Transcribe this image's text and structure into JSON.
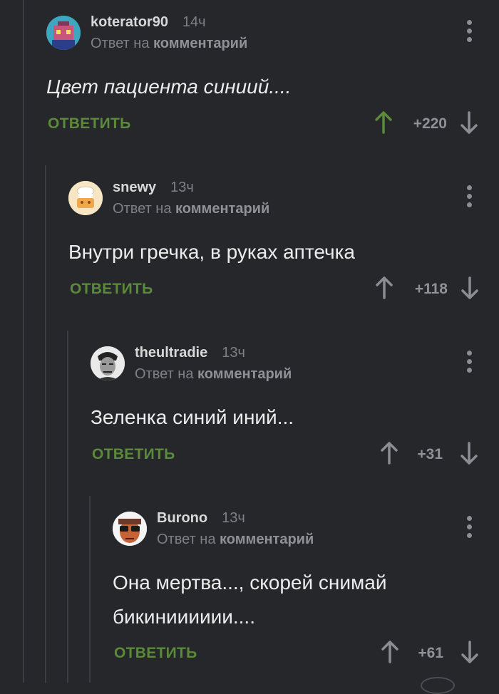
{
  "reply_prefix": "Ответ на",
  "reply_target": "комментарий",
  "reply_label": "ОТВЕТИТЬ",
  "colors": {
    "background": "#25272b",
    "upvote_active": "#5a8a3a",
    "reply": "#5a8a3a",
    "muted": "#8e9196"
  },
  "comments": [
    {
      "author": "koterator90",
      "time": "14ч",
      "text": "Цвет пациента синиий....",
      "score": "+220",
      "upvoted": true
    },
    {
      "author": "snewy",
      "time": "13ч",
      "text": "Внутри гречка, в руках аптечка",
      "score": "+118",
      "upvoted": false
    },
    {
      "author": "theultradie",
      "time": "13ч",
      "text": "Зеленка синий иний...",
      "score": "+31",
      "upvoted": false
    },
    {
      "author": "Burono",
      "time": "13ч",
      "text": "Она мертва..., скорей снимай бикинииииии....",
      "score": "+61",
      "upvoted": false
    }
  ]
}
